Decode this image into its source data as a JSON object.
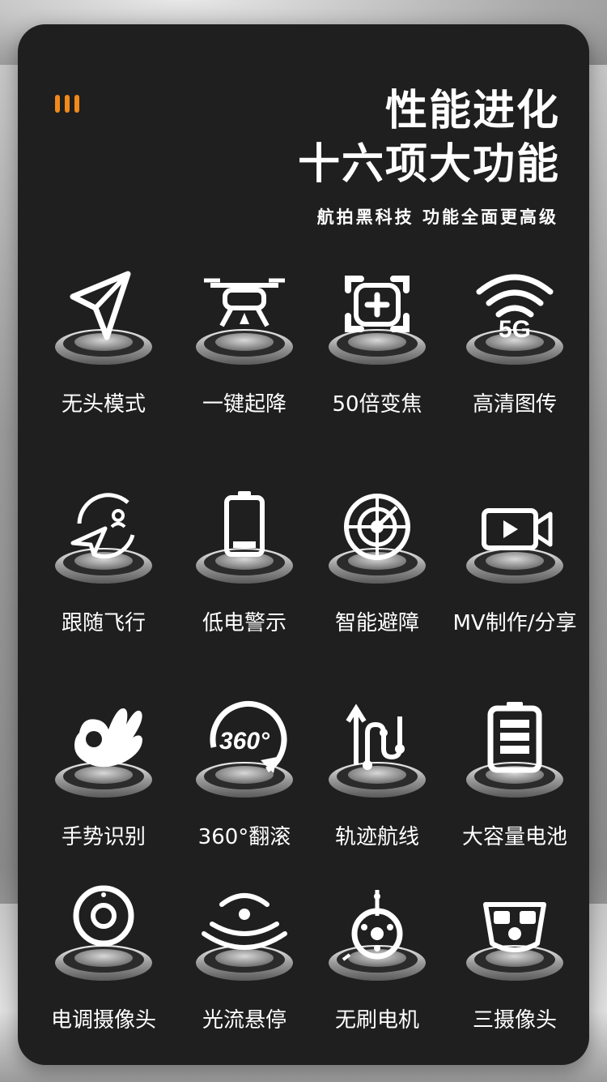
{
  "header": {
    "title_line1": "性能进化",
    "title_line2": "十六项大功能",
    "subtitle": "航拍黑科技 功能全面更高级",
    "accent_color": "#f08a1c"
  },
  "features": [
    {
      "label": "无头模式",
      "icon": "paper-plane-icon"
    },
    {
      "label": "一键起降",
      "icon": "drone-icon"
    },
    {
      "label": "50倍变焦",
      "icon": "zoom-frame-icon"
    },
    {
      "label": "高清图传",
      "icon": "5g-wifi-icon"
    },
    {
      "label": "跟随飞行",
      "icon": "follow-plane-icon"
    },
    {
      "label": "低电警示",
      "icon": "low-battery-icon"
    },
    {
      "label": "智能避障",
      "icon": "radar-icon"
    },
    {
      "label": "MV制作/分享",
      "icon": "video-camera-icon"
    },
    {
      "label": "手势识别",
      "icon": "ok-hand-icon"
    },
    {
      "label": "360°翻滚",
      "icon": "rotate-360-icon"
    },
    {
      "label": "轨迹航线",
      "icon": "flight-path-icon"
    },
    {
      "label": "大容量电池",
      "icon": "battery-full-icon"
    },
    {
      "label": "电调摄像头",
      "icon": "webcam-icon"
    },
    {
      "label": "光流悬停",
      "icon": "optical-flow-icon"
    },
    {
      "label": "无刷电机",
      "icon": "brushless-motor-icon"
    },
    {
      "label": "三摄像头",
      "icon": "triple-camera-icon"
    }
  ],
  "icons_5g_text": "5G",
  "icons_360_text": "360°"
}
